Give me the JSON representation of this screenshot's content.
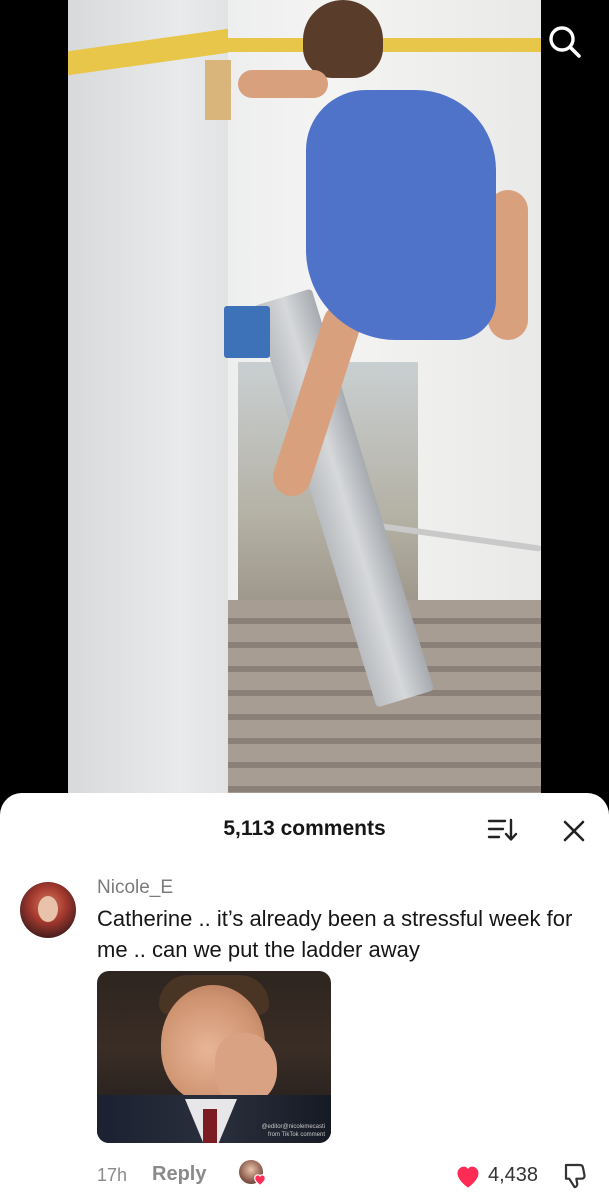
{
  "video": {
    "search_icon": "search-icon"
  },
  "comments_panel": {
    "count_label": "5,113 comments",
    "sort_icon": "sort-icon",
    "close_icon": "close-icon"
  },
  "comment": {
    "username": "Nicole_E",
    "text": "Catherine .. it’s already been a stressful week for me .. can we put the ladder away",
    "gif_watermark_line1": "@editor@nicolemecasti",
    "gif_watermark_line2": "from TikTok comment",
    "time": "17h",
    "reply_label": "Reply",
    "likes": "4,438",
    "liked": true,
    "creator_liked": true,
    "like_color": "#fe2c55"
  }
}
